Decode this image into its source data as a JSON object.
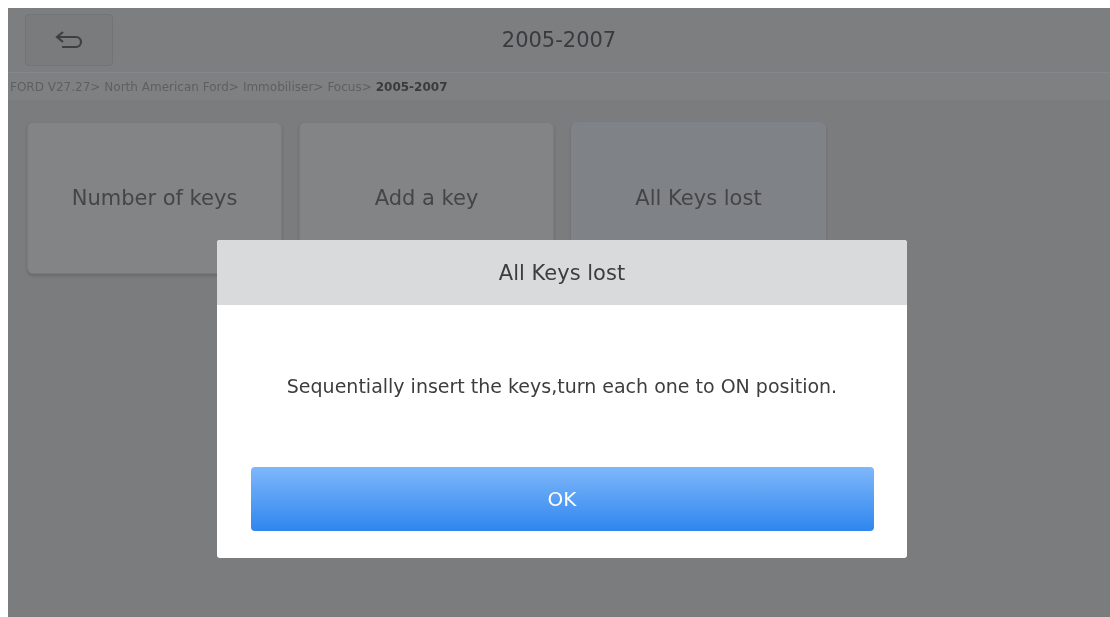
{
  "header": {
    "title": "2005-2007"
  },
  "breadcrumb": [
    {
      "label": "FORD V27.27>",
      "current": false
    },
    {
      "label": "North American Ford>",
      "current": false
    },
    {
      "label": "Immobiliser>",
      "current": false
    },
    {
      "label": "Focus>",
      "current": false
    },
    {
      "label": "2005-2007",
      "current": true
    }
  ],
  "tiles": [
    {
      "label": "Number of keys",
      "selected": false
    },
    {
      "label": "Add a key",
      "selected": false
    },
    {
      "label": "All Keys lost",
      "selected": true
    }
  ],
  "dialog": {
    "title": "All Keys lost",
    "message": "Sequentially insert the keys,turn each one to ON position.",
    "buttons": [
      "OK"
    ]
  }
}
